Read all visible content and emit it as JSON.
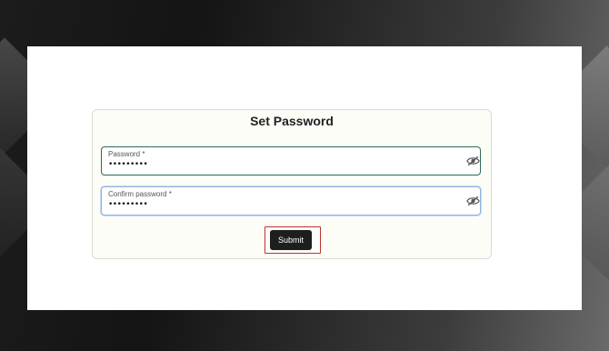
{
  "form": {
    "title": "Set Password",
    "password": {
      "label": "Password *",
      "value": "•••••••••",
      "toggle_icon": "eye-off-icon"
    },
    "confirm_password": {
      "label": "Confirm password *",
      "value": "•••••••••",
      "toggle_icon": "eye-off-icon"
    },
    "submit_label": "Submit"
  },
  "colors": {
    "submit_bg": "#1e1e1e",
    "focus_border": "#8fb4e0",
    "field_border": "#2f6b56",
    "highlight_border": "#c0322f"
  }
}
